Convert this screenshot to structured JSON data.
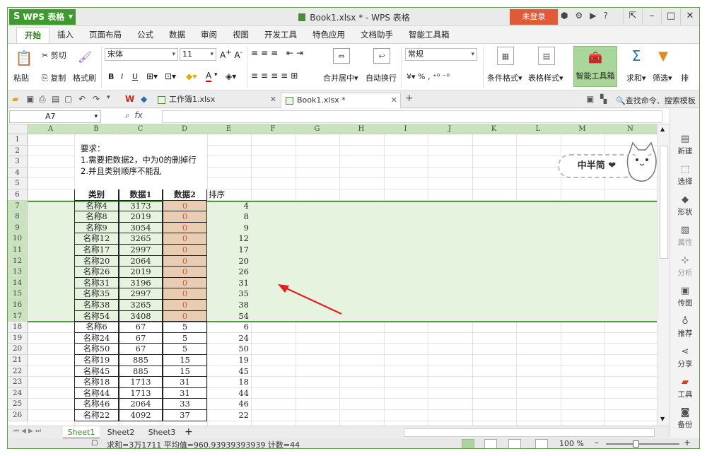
{
  "titlebar": {
    "app_button": "WPS 表格",
    "window_title": "Book1.xlsx * - WPS 表格",
    "login": "未登录"
  },
  "menu": [
    "开始",
    "插入",
    "页面布局",
    "公式",
    "数据",
    "审阅",
    "视图",
    "开发工具",
    "特色应用",
    "文档助手",
    "智能工具箱"
  ],
  "ribbon": {
    "paste": "粘贴",
    "cut": "剪切",
    "copy": "复制",
    "format_painter": "格式刷",
    "font_name": "宋体",
    "font_size": "11",
    "merge_center": "合并居中",
    "wrap_text": "自动换行",
    "number_format": "常规",
    "conditional_format": "条件格式",
    "table_style": "表格样式",
    "smart_toolbox": "智能工具箱",
    "sum": "求和",
    "filter": "筛选",
    "sort": "排"
  },
  "tabs": {
    "doc1": "工作簿1.xlsx",
    "doc2": "Book1.xlsx *",
    "search": "查找命令、搜索模板"
  },
  "formula_bar": {
    "name_box": "A7",
    "fx": "fx",
    "formula": ""
  },
  "columns": [
    "A",
    "B",
    "C",
    "D",
    "E",
    "F",
    "G",
    "H",
    "I",
    "J",
    "K",
    "L",
    "M",
    "N"
  ],
  "rows": [
    "1",
    "2",
    "3",
    "4",
    "5",
    "6",
    "7",
    "8",
    "9",
    "10",
    "11",
    "12",
    "13",
    "14",
    "15",
    "16",
    "17",
    "18",
    "19",
    "20",
    "21",
    "22",
    "23",
    "24",
    "25",
    "26"
  ],
  "requirements": {
    "line1": "要求：",
    "line2": "1.需要把数据2，中为0的删掉行",
    "line3": "2.并且类别顺序不能乱"
  },
  "table": {
    "headers": [
      "类别",
      "数据1",
      "数据2",
      "排序"
    ],
    "rows": [
      [
        "名称4",
        "3173",
        "0",
        "4"
      ],
      [
        "名称8",
        "2019",
        "0",
        "8"
      ],
      [
        "名称9",
        "3054",
        "0",
        "9"
      ],
      [
        "名称12",
        "3265",
        "0",
        "12"
      ],
      [
        "名称17",
        "2997",
        "0",
        "17"
      ],
      [
        "名称20",
        "2064",
        "0",
        "20"
      ],
      [
        "名称26",
        "2019",
        "0",
        "26"
      ],
      [
        "名称31",
        "3196",
        "0",
        "31"
      ],
      [
        "名称35",
        "2997",
        "0",
        "35"
      ],
      [
        "名称38",
        "3265",
        "0",
        "38"
      ],
      [
        "名称54",
        "3408",
        "0",
        "54"
      ],
      [
        "名称6",
        "67",
        "5",
        "6"
      ],
      [
        "名称24",
        "67",
        "5",
        "24"
      ],
      [
        "名称50",
        "67",
        "5",
        "50"
      ],
      [
        "名称19",
        "885",
        "15",
        "19"
      ],
      [
        "名称45",
        "885",
        "15",
        "45"
      ],
      [
        "名称18",
        "1713",
        "31",
        "18"
      ],
      [
        "名称44",
        "1713",
        "31",
        "44"
      ],
      [
        "名称46",
        "2064",
        "33",
        "46"
      ],
      [
        "名称22",
        "4092",
        "37",
        "22"
      ]
    ]
  },
  "sticker": "中半简 ❤",
  "sidebar": [
    "新建",
    "选择",
    "形状",
    "属性",
    "分析",
    "传图",
    "推荐",
    "分享",
    "工具",
    "备份"
  ],
  "sheets": [
    "Sheet1",
    "Sheet2",
    "Sheet3"
  ],
  "status": {
    "summary": "求和=3万1711  平均值=960.93939393939  计数=44",
    "zoom": "100 %"
  },
  "colors": {
    "accent": "#3e9a2e",
    "selection": "#e6f4df",
    "zero_cell": "#e8cdb3",
    "arrow": "#e02020"
  }
}
